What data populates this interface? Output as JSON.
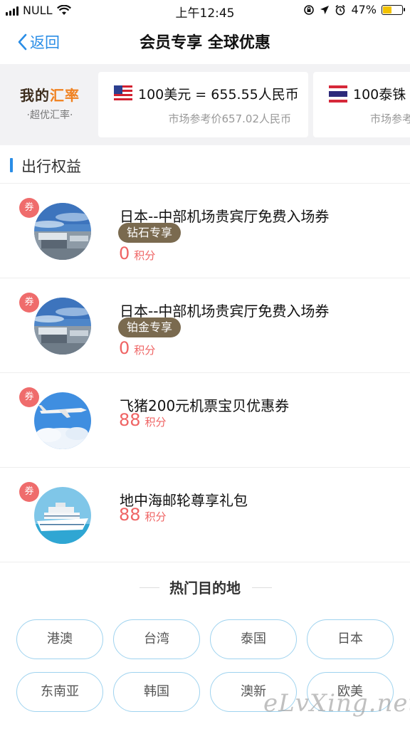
{
  "status_bar": {
    "carrier": "NULL",
    "time": "上午12:45",
    "battery": "47%",
    "battery_level": 0.47
  },
  "nav": {
    "back_label": "返回",
    "title": "会员专享 全球优惠"
  },
  "exchange": {
    "logo_part1": "我的",
    "logo_part2": "汇率",
    "logo_sub": "·超优汇率·",
    "cards": [
      {
        "flag": "us-flag-icon",
        "rate": "100美元 = 655.55人民币",
        "market": "市场参考价657.02人民币"
      },
      {
        "flag": "thai-flag-icon",
        "rate": "100泰铢 =",
        "market": "市场参考"
      }
    ]
  },
  "section": {
    "title": "出行权益"
  },
  "coupons": [
    {
      "tag": "券",
      "image": "airport-lounge-image",
      "name": "日本--中部机场贵宾厅免费入场券",
      "badge": "钻石专享",
      "price": "0",
      "unit": "积分"
    },
    {
      "tag": "券",
      "image": "airport-lounge-image",
      "name": "日本--中部机场贵宾厅免费入场券",
      "badge": "铂金专享",
      "price": "0",
      "unit": "积分"
    },
    {
      "tag": "券",
      "image": "airplane-image",
      "name": "飞猪200元机票宝贝优惠券",
      "badge": "",
      "price": "88",
      "unit": "积分"
    },
    {
      "tag": "券",
      "image": "cruise-ship-image",
      "name": "地中海邮轮尊享礼包",
      "badge": "",
      "price": "88",
      "unit": "积分"
    }
  ],
  "hot": {
    "title": "热门目的地",
    "destinations": [
      "港澳",
      "台湾",
      "泰国",
      "日本",
      "东南亚",
      "韩国",
      "澳新",
      "欧美"
    ]
  },
  "watermark": "eLvXing.net",
  "colors": {
    "accent": "#2a8de6",
    "price": "#ef6464",
    "badge": "#7a6a4f",
    "tag": "#ef6c6c",
    "dest_border": "#9fd3ef"
  }
}
